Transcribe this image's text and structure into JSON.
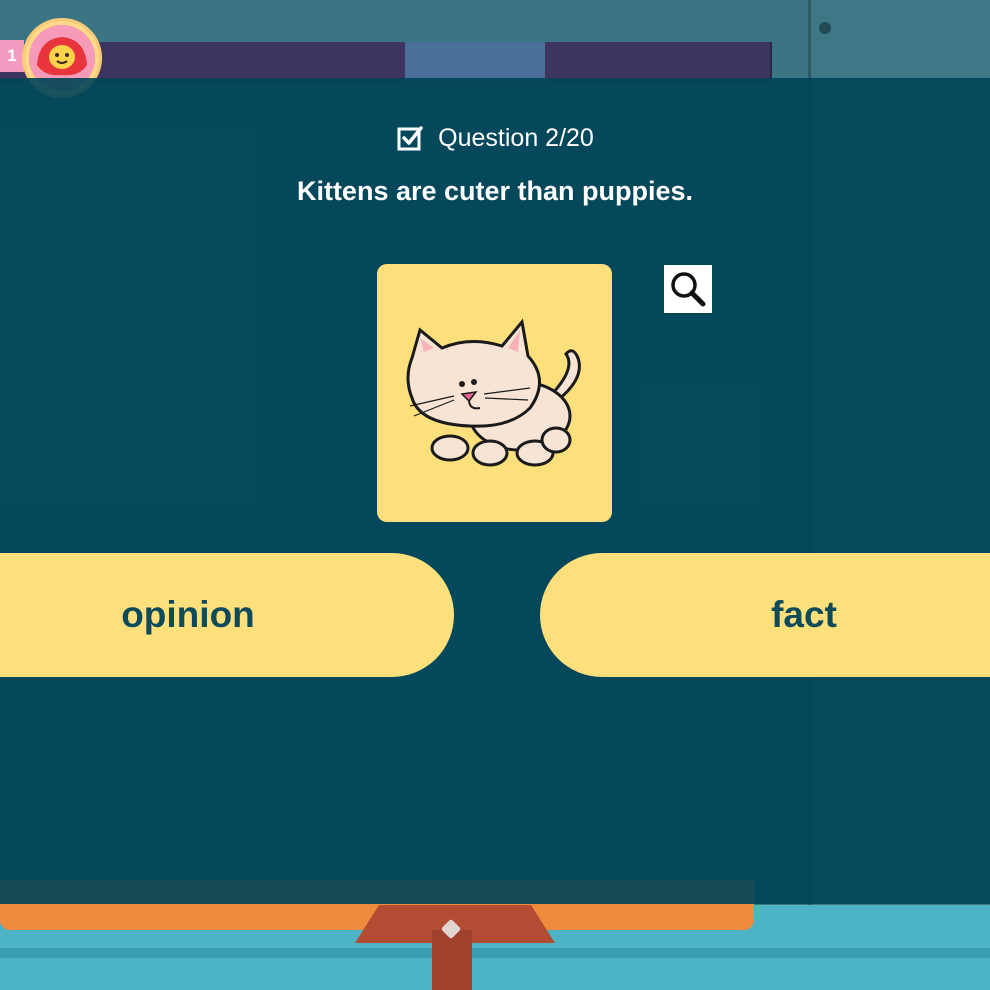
{
  "player": {
    "number": "1",
    "avatar_icon": "red-hat-character-icon"
  },
  "question": {
    "counter": "Question 2/20",
    "text": "Kittens are cuter than puppies.",
    "image_icon": "kitten-illustration",
    "zoom_icon": "magnifying-glass-icon",
    "check_icon": "checkbox-checked-icon"
  },
  "answers": [
    {
      "label": "opinion"
    },
    {
      "label": "fact"
    }
  ],
  "colors": {
    "overlay": "#004458",
    "answer_bg": "#fde07c",
    "answer_text": "#0d4a5a",
    "floor": "#4db4c8",
    "orange_plate": "#f08a3c"
  }
}
